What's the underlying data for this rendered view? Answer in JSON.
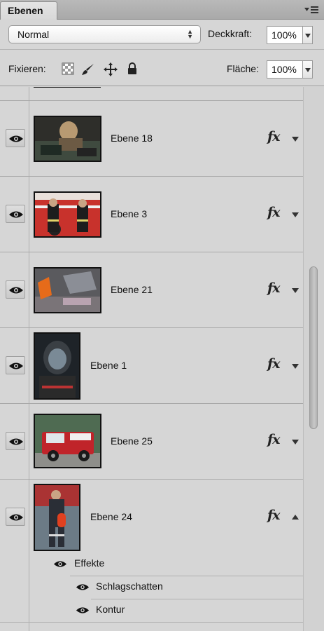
{
  "panel": {
    "tab_label": "Ebenen",
    "menu_icon": "panel-menu-icon"
  },
  "options": {
    "blend_mode": "Normal",
    "opacity_label": "Deckkraft:",
    "opacity_value": "100%",
    "lock_label": "Fixieren:",
    "lock_icons": [
      "lock-transparent-pixels-icon",
      "lock-image-pixels-icon",
      "lock-position-icon",
      "lock-all-icon"
    ],
    "fill_label": "Fläche:",
    "fill_value": "100%"
  },
  "layers": [
    {
      "name": "Ebene 18",
      "visible": true,
      "has_fx": true,
      "fx_expanded": false,
      "thumb_icon": "photo-firefighters-resting"
    },
    {
      "name": "Ebene 3",
      "visible": true,
      "has_fx": true,
      "fx_expanded": false,
      "thumb_icon": "photo-firefighters-truck"
    },
    {
      "name": "Ebene 21",
      "visible": true,
      "has_fx": true,
      "fx_expanded": false,
      "thumb_icon": "photo-gear-on-ground"
    },
    {
      "name": "Ebene 1",
      "visible": true,
      "has_fx": true,
      "fx_expanded": false,
      "thumb_icon": "photo-firefighter-mask"
    },
    {
      "name": "Ebene 25",
      "visible": true,
      "has_fx": true,
      "fx_expanded": false,
      "thumb_icon": "photo-fire-vehicle"
    },
    {
      "name": "Ebene 24",
      "visible": true,
      "has_fx": true,
      "fx_expanded": true,
      "thumb_icon": "photo-firefighter-standing"
    }
  ],
  "effects": {
    "group_label": "Effekte",
    "items": [
      "Schlagschatten",
      "Kontur"
    ]
  },
  "fx_label": "fx",
  "colors": {
    "panel_bg": "#d6d6d6",
    "tab_bg": "#e0e0e0",
    "divider": "#a8a8a8"
  }
}
